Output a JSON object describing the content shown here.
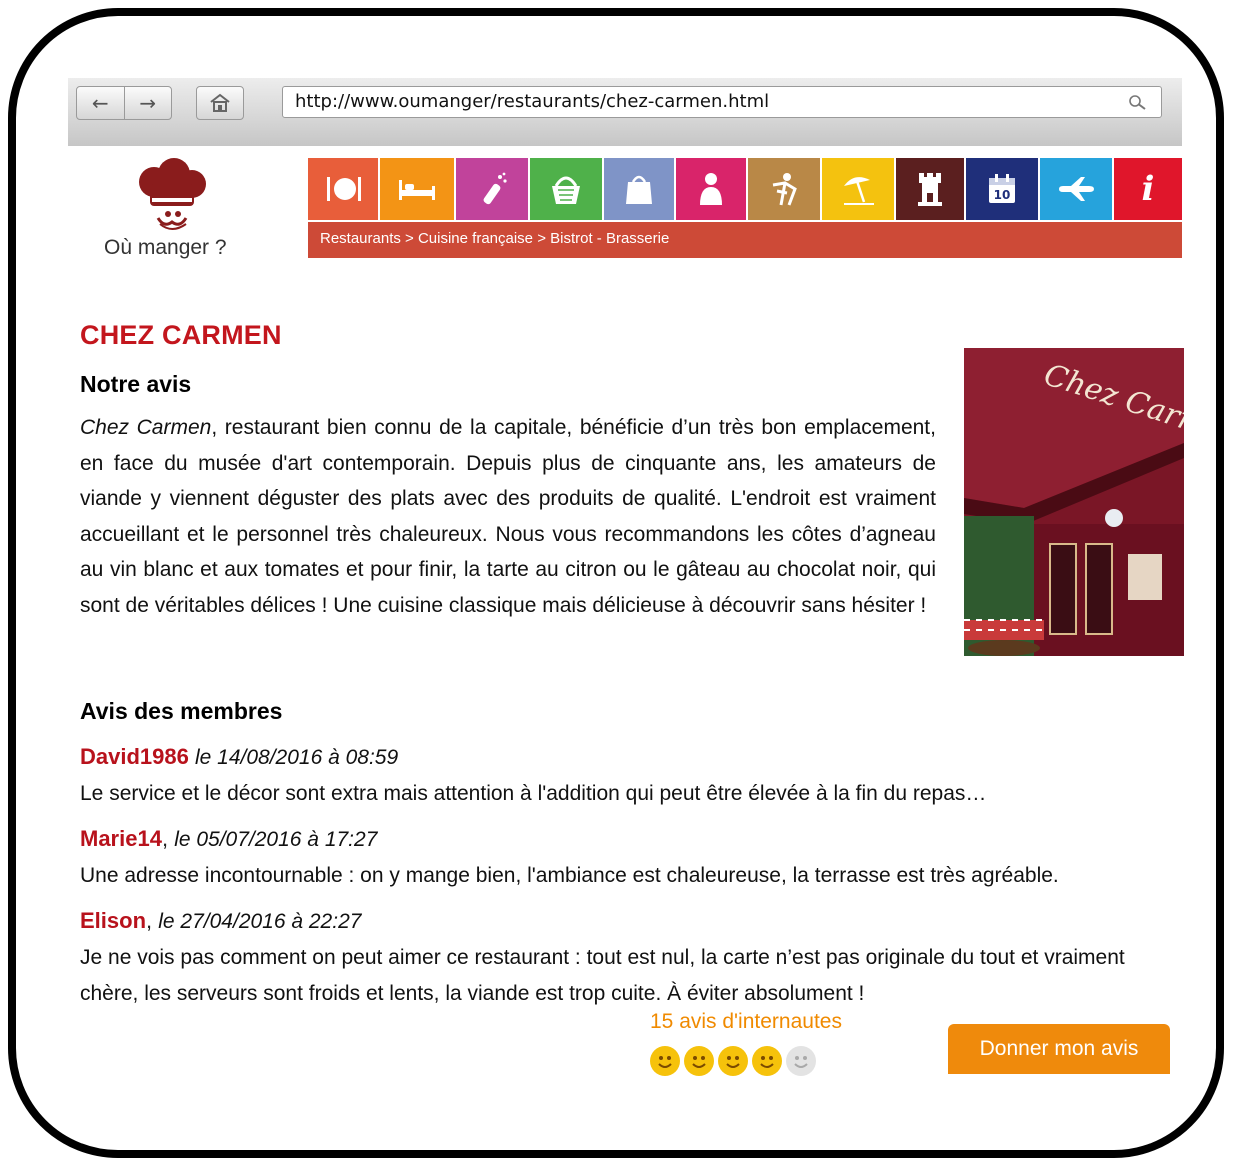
{
  "browser": {
    "back_glyph": "←",
    "forward_glyph": "→",
    "url": "http://www.oumanger/restaurants/chez-carmen.html",
    "icons": [
      "back-arrow-icon",
      "forward-arrow-icon",
      "home-icon",
      "search-icon"
    ]
  },
  "site": {
    "logo_text": "Où manger ?",
    "logo_icon": "chef-hat-icon"
  },
  "categories": [
    {
      "icon": "plate-cutlery-icon",
      "color": "#e85e3a"
    },
    {
      "icon": "bed-icon",
      "color": "#f39415"
    },
    {
      "icon": "champagne-icon",
      "color": "#c1439b"
    },
    {
      "icon": "basket-icon",
      "color": "#4fb14a"
    },
    {
      "icon": "shopping-bag-icon",
      "color": "#7f94c7"
    },
    {
      "icon": "person-icon",
      "color": "#d9246a"
    },
    {
      "icon": "gesture-icon",
      "color": "#b98847"
    },
    {
      "icon": "beach-umbrella-icon",
      "color": "#f4c20f"
    },
    {
      "icon": "castle-tower-icon",
      "color": "#5b1f1f"
    },
    {
      "icon": "calendar-icon",
      "color": "#1f2f7a"
    },
    {
      "icon": "airplane-icon",
      "color": "#26a3dc"
    },
    {
      "icon": "info-icon",
      "color": "#e0162b",
      "glyph": "i"
    }
  ],
  "calendar_day": "10",
  "breadcrumb": "Restaurants > Cuisine française > Bistrot - Brasserie",
  "restaurant": {
    "name": "CHEZ CARMEN",
    "our_review_heading": "Notre avis",
    "our_review_italic": "Chez Carmen",
    "our_review_text": ", restaurant bien connu de la capitale, bénéficie d’un très bon emplacement, en face du musée d'art contemporain. Depuis plus de cinquante ans, les amateurs de viande y viennent déguster des plats avec des produits de qualité. L'endroit est vraiment accueillant et le personnel très chaleureux. Nous vous recommandons les côtes d’agneau au vin blanc et aux tomates et pour finir, la tarte au citron ou le gâteau au chocolat noir, qui sont de véritables délices ! Une cuisine classique mais délicieuse à découvrir sans hésiter !",
    "photo_sign_text": "Chez Carmen"
  },
  "members": {
    "heading": "Avis des membres",
    "reviews": [
      {
        "name": "David1986",
        "sep": " ",
        "date": "le 14/08/2016 à 08:59",
        "text": "Le service et le décor sont extra mais attention à l'addition qui peut être élevée à la fin du repas…"
      },
      {
        "name": "Marie14",
        "sep": ", ",
        "date": "le 05/07/2016 à 17:27",
        "text": "Une adresse incontournable : on y mange bien, l'ambiance est chaleureuse, la terrasse est très agréable."
      },
      {
        "name": "Elison",
        "sep": ", ",
        "date": "le 27/04/2016 à 22:27",
        "text": "Je ne vois pas comment on peut aimer ce restaurant : tout est nul, la carte n’est pas originale du tout et vraiment chère, les serveurs sont froids et lents, la viande est trop cuite. À éviter absolument !"
      }
    ]
  },
  "rating": {
    "count_label": "15 avis d'internautes",
    "score": 4,
    "max": 5,
    "icon": "smiley-icon",
    "active_color": "#f6c20b",
    "inactive_color": "#e3e3e3"
  },
  "cta": {
    "label": "Donner mon avis",
    "color": "#ef8a0c"
  }
}
